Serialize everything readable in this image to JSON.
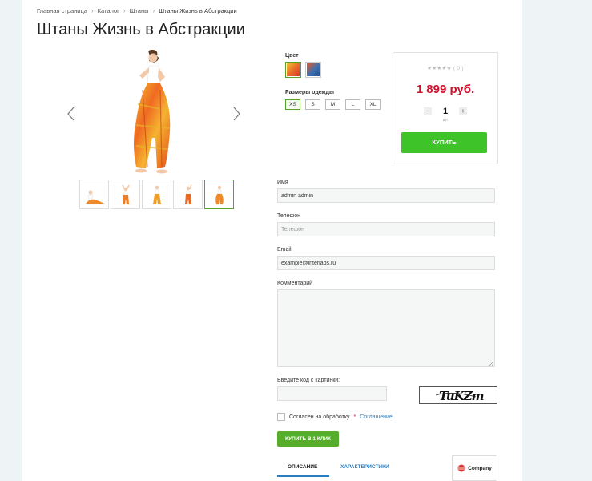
{
  "breadcrumb": [
    "Главная страница",
    "Каталог",
    "Штаны",
    "Штаны Жизнь в Абстракции"
  ],
  "title": "Штаны Жизнь в Абстракции",
  "gallery": {
    "thumbs": [
      "thumb-1",
      "thumb-2",
      "thumb-3",
      "thumb-4",
      "thumb-5"
    ],
    "active_thumb": 5
  },
  "options": {
    "color_label": "Цвет",
    "colors": [
      "#e8682a",
      "#3a6fb0"
    ],
    "size_label": "Размеры одежды",
    "sizes": [
      "XS",
      "S",
      "M",
      "L",
      "XL"
    ],
    "selected_size": "XS"
  },
  "buybox": {
    "rating": "★★★★★ ( 0 )",
    "price": "1 899 руб.",
    "qty_minus": "−",
    "qty": "1",
    "qty_plus": "+",
    "unit": "шт",
    "buy_label": "КУПИТЬ"
  },
  "form": {
    "name_label": "Имя",
    "name_value": "admin admin",
    "phone_label": "Телефон",
    "phone_placeholder": "Телефон",
    "email_label": "Email",
    "email_value": "example@interlabs.ru",
    "comment_label": "Комментарий",
    "captcha_label": "Введите код с картинки:",
    "captcha_text": "TuKZm",
    "agree_text": "Согласен на обработку",
    "agree_star": "*",
    "agree_link": "Соглашение",
    "submit_label": "КУПИТЬ В 1 КЛИК"
  },
  "tabs": {
    "description": "ОПИСАНИЕ",
    "specs": "ХАРАКТЕРИСТИКИ"
  },
  "company": "Company",
  "colors": {
    "accent_green": "#3ec328",
    "price_red": "#d0112b",
    "link_blue": "#2a7dc0"
  }
}
